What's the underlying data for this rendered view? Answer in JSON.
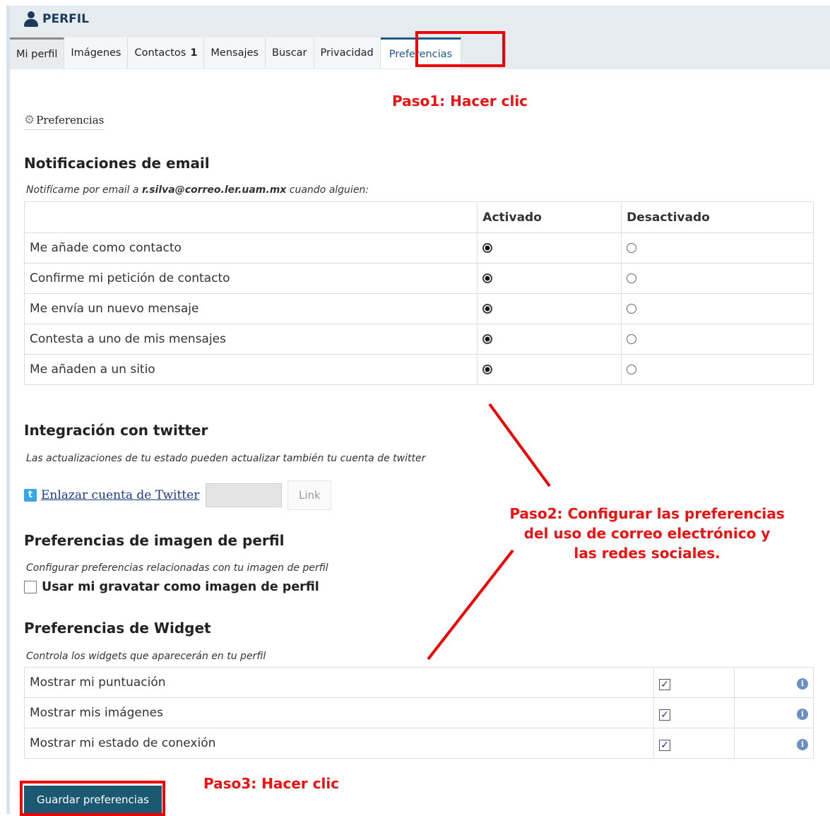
{
  "portlet": {
    "title": "PERFIL"
  },
  "tabs": [
    {
      "label": "Mi perfil"
    },
    {
      "label": "Imágenes"
    },
    {
      "label": "Contactos",
      "badge": "1"
    },
    {
      "label": "Mensajes"
    },
    {
      "label": "Buscar"
    },
    {
      "label": "Privacidad"
    },
    {
      "label": "Preferencias"
    }
  ],
  "annotations": {
    "paso1": "Paso1: Hacer clic",
    "paso2_line1": "Paso2: Configurar las preferencias",
    "paso2_line2": "del uso de correo electrónico y",
    "paso2_line3": "las redes sociales.",
    "paso3": "Paso3: Hacer clic"
  },
  "preferences_link": "Preferencias",
  "email_notifications": {
    "title": "Notificaciones de email",
    "desc_prefix": "Notifícame por email a ",
    "email": "r.silva@correo.ler.uam.mx",
    "desc_suffix": " cuando alguien:",
    "col_enabled": "Activado",
    "col_disabled": "Desactivado",
    "rows": [
      {
        "label": "Me añade como contacto",
        "enabled": true
      },
      {
        "label": "Confirme mi petición de contacto",
        "enabled": true
      },
      {
        "label": "Me envía un nuevo mensaje",
        "enabled": true
      },
      {
        "label": "Contesta a uno de mis mensajes",
        "enabled": true
      },
      {
        "label": "Me añaden a un sitio",
        "enabled": true
      }
    ]
  },
  "twitter": {
    "title": "Integración con twitter",
    "desc": "Las actualizaciones de tu estado pueden actualizar también tu cuenta de twitter",
    "link_label": "Enlazar cuenta de Twitter",
    "button_label": "Link",
    "input_value": ""
  },
  "profile_image": {
    "title": "Preferencias de imagen de perfil",
    "desc": "Configurar preferencias relacionadas con tu imagen de perfil",
    "gravatar_label": "Usar mi gravatar como imagen de perfil",
    "gravatar_checked": false
  },
  "widgets": {
    "title": "Preferencias de Widget",
    "desc": "Controla los widgets que aparecerán en tu perfil",
    "rows": [
      {
        "label": "Mostrar mi puntuación",
        "checked": true
      },
      {
        "label": "Mostrar mis imágenes",
        "checked": true
      },
      {
        "label": "Mostrar mi estado de conexión",
        "checked": true
      }
    ]
  },
  "save_button": "Guardar preferencias",
  "colors": {
    "annotation": "#ee0000",
    "accent": "#1b5872",
    "header_bg": "#e6ebf0"
  },
  "icons": [
    "user-icon",
    "gear-icon",
    "twitter-icon",
    "info-icon"
  ]
}
